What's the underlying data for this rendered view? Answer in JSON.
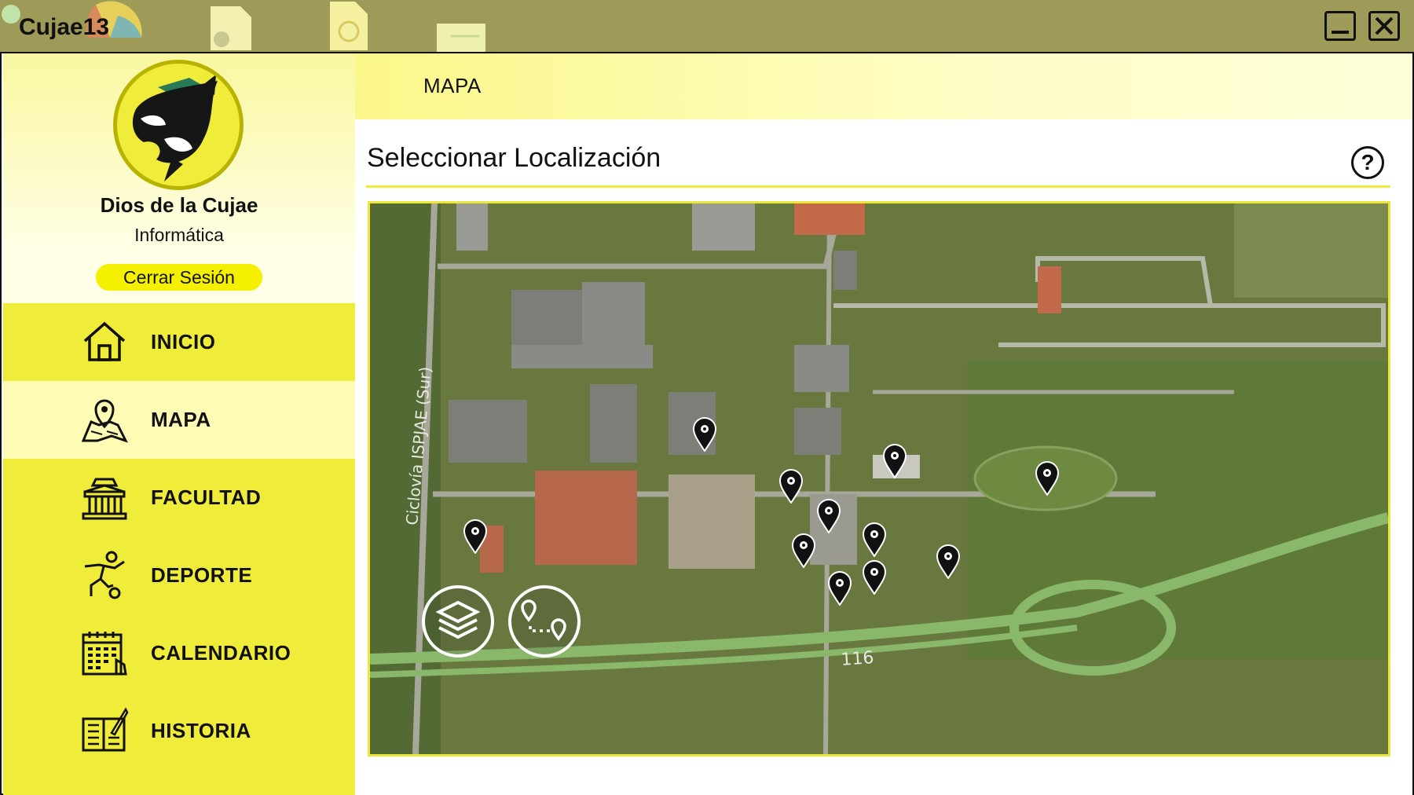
{
  "window": {
    "title": "Cujae13",
    "minimize_icon": "minimize-icon",
    "close_icon": "close-icon"
  },
  "profile": {
    "name": "Dios de la Cujae",
    "department": "Informática",
    "logout_label": "Cerrar Sesión",
    "avatar_icon": "orca-avatar"
  },
  "menu": {
    "items": [
      {
        "label": "INICIO",
        "icon": "home-icon",
        "active": false
      },
      {
        "label": "MAPA",
        "icon": "map-icon",
        "active": true
      },
      {
        "label": "FACULTAD",
        "icon": "building-icon",
        "active": false
      },
      {
        "label": "DEPORTE",
        "icon": "soccer-icon",
        "active": false
      },
      {
        "label": "CALENDARIO",
        "icon": "calendar-icon",
        "active": false
      },
      {
        "label": "HISTORIA",
        "icon": "book-icon",
        "active": false
      }
    ]
  },
  "main": {
    "header_title": "MAPA",
    "section_title": "Seleccionar Localización",
    "help_label": "?"
  },
  "map": {
    "road_label": "Ciclovía ISPJAE (Sur)",
    "road_number": "116",
    "controls": [
      "layers-icon",
      "route-icon"
    ]
  },
  "colors": {
    "sidebar": "#f0ec3a",
    "accent": "#f5f000",
    "titlebar": "#9e9a57"
  }
}
